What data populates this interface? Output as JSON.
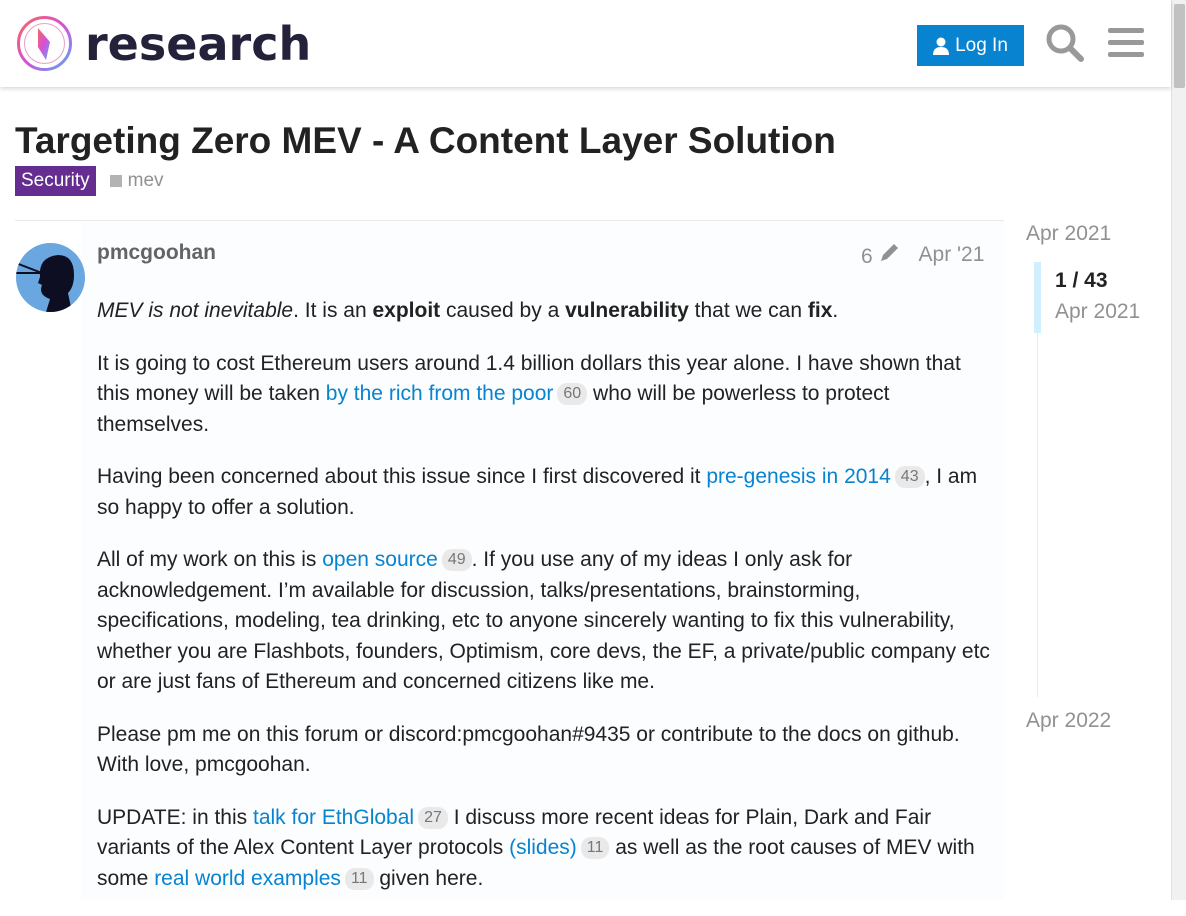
{
  "header": {
    "site_name": "research",
    "login_label": "Log In"
  },
  "topic": {
    "title": "Targeting Zero MEV - A Content Layer Solution",
    "category": "Security",
    "category_color": "#652d90",
    "tag": "mev"
  },
  "post": {
    "username": "pmcgoohan",
    "edits": "6",
    "date": "Apr '21",
    "p1": {
      "a": "MEV is not inevitable",
      "b": ". It is an ",
      "c": "exploit",
      "d": " caused by a ",
      "e": "vulnerability",
      "f": " that we can ",
      "g": "fix",
      "h": "."
    },
    "p2": {
      "a": "It is going to cost Ethereum users around 1.4 billion dollars this year alone. I have shown that this money will be taken ",
      "link": "by the rich from the poor",
      "count": "60",
      "b": " who will be powerless to protect themselves."
    },
    "p3": {
      "a": "Having been concerned about this issue since I first discovered it ",
      "link": "pre-genesis in 2014",
      "count": "43",
      "b": ", I am so happy to offer a solution."
    },
    "p4": {
      "a": "All of my work on this is ",
      "link": "open source",
      "count": "49",
      "b": ". If you use any of my ideas I only ask for acknowledgement. I’m available for discussion, talks/presentations, brainstorming, specifications, modeling, tea drinking, etc to anyone sincerely wanting to fix this vulnerability, whether you are Flashbots, founders, Optimism, core devs, the EF, a private/public company etc or are just fans of Ethereum and concerned citizens like me."
    },
    "p5": "Please pm me on this forum or discord:pmcgoohan#9435 or contribute to the docs on github. With love, pmcgoohan.",
    "p6": {
      "a": "UPDATE: in this ",
      "link1": "talk for EthGlobal",
      "count1": "27",
      "b": " I discuss more recent ideas for Plain, Dark and Fair variants of the Alex Content Layer protocols ",
      "link2": "(slides)",
      "count2": "11",
      "c": " as well as the root causes of MEV with some ",
      "link3": "real world examples",
      "count3": "11",
      "d": " given here."
    }
  },
  "timeline": {
    "start": "Apr 2021",
    "position": "1 / 43",
    "position_date": "Apr 2021",
    "end": "Apr 2022"
  }
}
